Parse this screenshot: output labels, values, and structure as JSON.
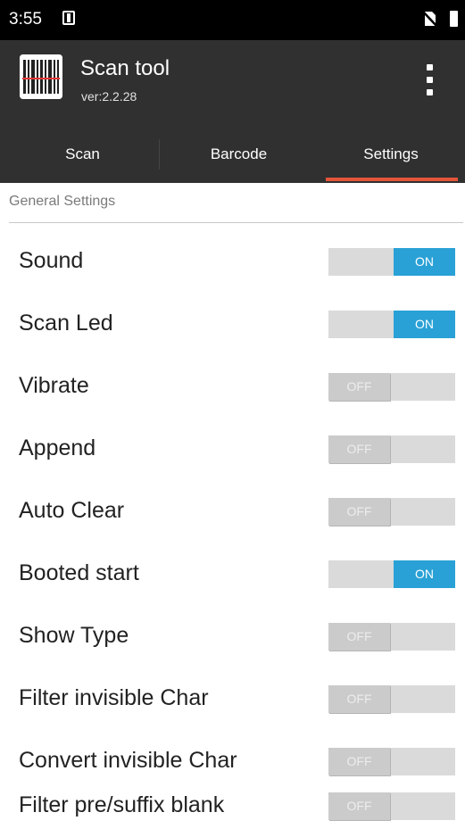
{
  "status_bar": {
    "time": "3:55",
    "icons": [
      "app-notification-icon",
      "no-sim-icon",
      "battery-icon"
    ]
  },
  "app_bar": {
    "title": "Scan tool",
    "version": "ver:2.2.28",
    "logo_icon": "barcode-icon",
    "menu_icon": "overflow-menu-icon"
  },
  "tabs": [
    {
      "label": "Scan",
      "selected": false
    },
    {
      "label": "Barcode",
      "selected": false
    },
    {
      "label": "Settings",
      "selected": true
    }
  ],
  "colors": {
    "accent": "#29a1d6",
    "tab_indicator": "#e5553a",
    "app_bar": "#303030"
  },
  "section": {
    "title": "General Settings"
  },
  "settings": [
    {
      "label": "Sound",
      "state": "ON"
    },
    {
      "label": "Scan Led",
      "state": "ON"
    },
    {
      "label": "Vibrate",
      "state": "OFF"
    },
    {
      "label": "Append",
      "state": "OFF"
    },
    {
      "label": "Auto Clear",
      "state": "OFF"
    },
    {
      "label": "Booted start",
      "state": "ON"
    },
    {
      "label": "Show Type",
      "state": "OFF"
    },
    {
      "label": "Filter invisible Char",
      "state": "OFF"
    },
    {
      "label": "Convert invisible Char",
      "state": "OFF"
    },
    {
      "label": "Filter pre/suffix blank",
      "state": "OFF"
    }
  ]
}
